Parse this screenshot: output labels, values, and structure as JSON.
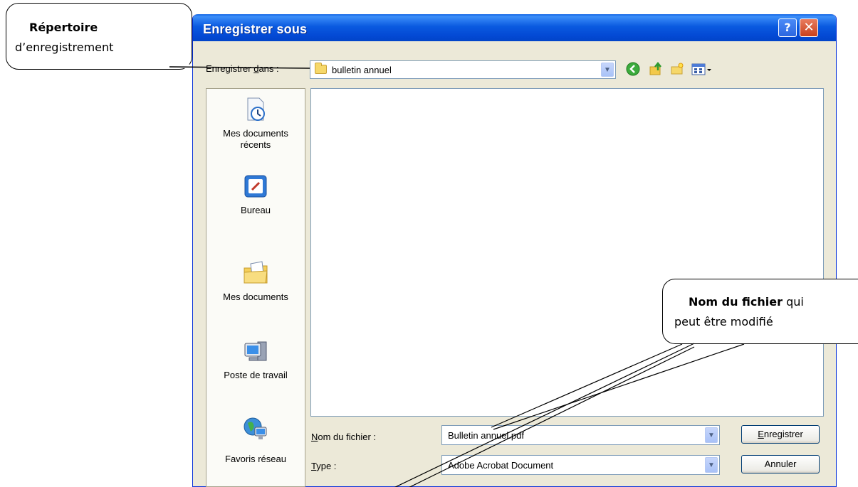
{
  "dialog": {
    "title": "Enregistrer sous",
    "help_glyph": "?",
    "close_glyph": "✕"
  },
  "save_in": {
    "label_pre": "Enregistrer ",
    "label_accel": "d",
    "label_post": "ans :",
    "value": "bulletin annuel"
  },
  "toolbar": {
    "icons": [
      "back-icon",
      "up-folder-icon",
      "new-folder-icon",
      "view-menu-icon"
    ]
  },
  "places": [
    {
      "label": "Mes documents récents",
      "icon": "recent-documents-icon"
    },
    {
      "label": "Bureau",
      "icon": "desktop-icon"
    },
    {
      "label": "Mes documents",
      "icon": "my-documents-icon"
    },
    {
      "label": "Poste de travail",
      "icon": "my-computer-icon"
    },
    {
      "label": "Favoris réseau",
      "icon": "network-places-icon"
    }
  ],
  "filename": {
    "label_accel": "N",
    "label_rest": "om du fichier :",
    "value": "Bulletin annuel.pdf"
  },
  "filetype": {
    "label_accel": "T",
    "label_rest": "ype :",
    "value": "Adobe Acrobat Document"
  },
  "buttons": {
    "save_accel": "E",
    "save_rest": "nregistrer",
    "cancel": "Annuler"
  },
  "callouts": {
    "directory_bold": "Répertoire",
    "directory_text": "d’enregistrement",
    "filename_bold": "Nom du fichier",
    "filename_text_1": " qui",
    "filename_text_2": "peut être modifié"
  }
}
